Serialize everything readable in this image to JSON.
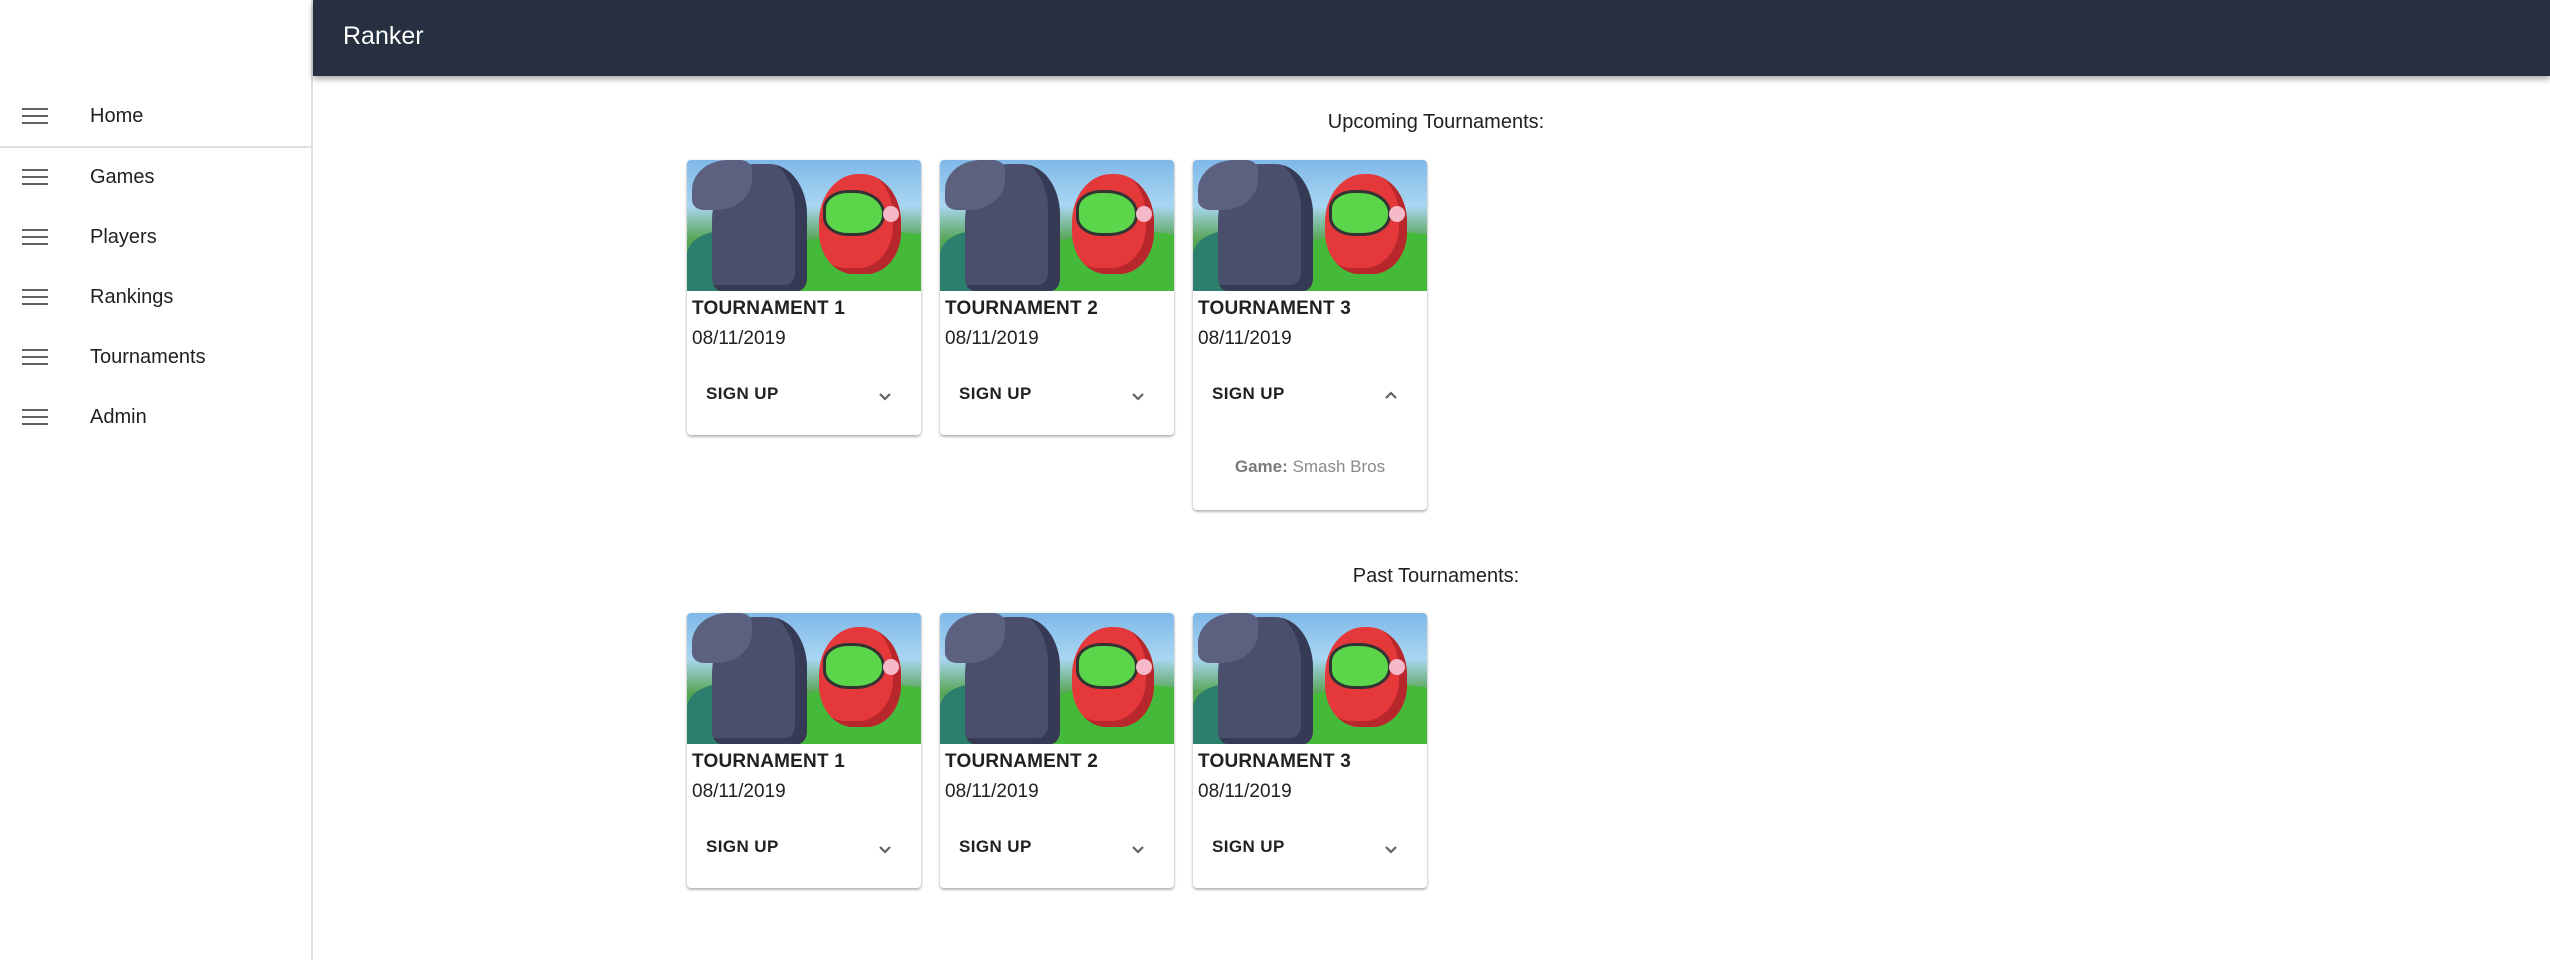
{
  "app": {
    "title": "Ranker"
  },
  "sidebar": {
    "items": [
      {
        "label": "Home"
      },
      {
        "label": "Games"
      },
      {
        "label": "Players"
      },
      {
        "label": "Rankings"
      },
      {
        "label": "Tournaments"
      },
      {
        "label": "Admin"
      }
    ]
  },
  "sections": {
    "upcoming": {
      "title": "Upcoming Tournaments:",
      "cards": [
        {
          "name": "TOURNAMENT 1",
          "date": "08/11/2019",
          "action": "SIGN UP",
          "expanded": false
        },
        {
          "name": "TOURNAMENT 2",
          "date": "08/11/2019",
          "action": "SIGN UP",
          "expanded": false
        },
        {
          "name": "TOURNAMENT 3",
          "date": "08/11/2019",
          "action": "SIGN UP",
          "expanded": true,
          "game_label": "Game:",
          "game_value": "Smash Bros"
        }
      ]
    },
    "past": {
      "title": "Past Tournaments:",
      "cards": [
        {
          "name": "TOURNAMENT 1",
          "date": "08/11/2019",
          "action": "SIGN UP",
          "expanded": false
        },
        {
          "name": "TOURNAMENT 2",
          "date": "08/11/2019",
          "action": "SIGN UP",
          "expanded": false
        },
        {
          "name": "TOURNAMENT 3",
          "date": "08/11/2019",
          "action": "SIGN UP",
          "expanded": false
        }
      ]
    }
  },
  "colors": {
    "appbar": "#263040",
    "appbar_text": "#ffffff",
    "divider": "#e0e0e0"
  },
  "icons": {
    "nav": "menu-icon",
    "collapsed": "chevron-down-icon",
    "expanded": "chevron-up-icon",
    "card_image": "tournament-image"
  }
}
